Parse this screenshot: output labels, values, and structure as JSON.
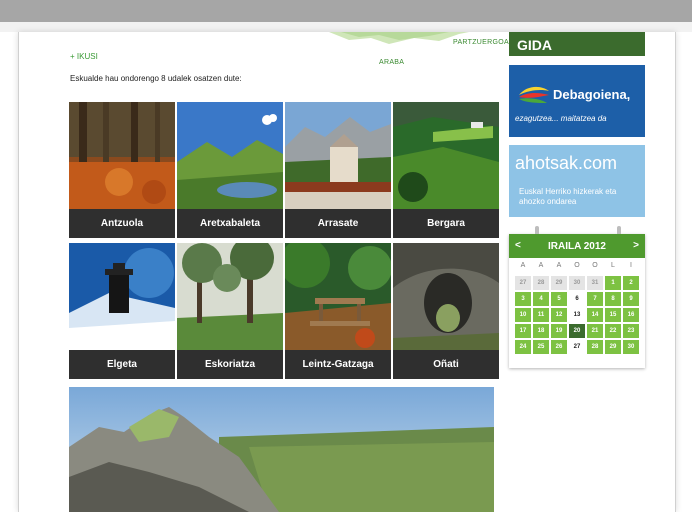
{
  "header": {
    "ikusi_link": "+ IKUSI",
    "intro": "Eskualde hau ondorengo 8 udalek osatzen dute:"
  },
  "map": {
    "label_partzuergoa": "PARTZUERGOA",
    "label_araba": "ARABA"
  },
  "towns": [
    {
      "name": "Antzuola"
    },
    {
      "name": "Aretxabaleta"
    },
    {
      "name": "Arrasate"
    },
    {
      "name": "Bergara"
    },
    {
      "name": "Elgeta"
    },
    {
      "name": "Eskoriatza"
    },
    {
      "name": "Leintz-Gatzaga"
    },
    {
      "name": "Oñati"
    }
  ],
  "sidebar": {
    "gida": "GIDA",
    "debagoiena": {
      "title": "Debagoiena,",
      "tagline": "ezagutzea... maitatzea da"
    },
    "ahotsak": {
      "title": "ahotsak.com",
      "tagline": "Euskal Herriko hizkerak eta ahozko ondarea"
    }
  },
  "calendar": {
    "prev": "<",
    "next": ">",
    "title": "IRAILA 2012",
    "day_headers": [
      "A",
      "A",
      "A",
      "O",
      "O",
      "L",
      "I"
    ],
    "rows": [
      [
        "27",
        "28",
        "29",
        "30",
        "31",
        "1",
        "2"
      ],
      [
        "3",
        "4",
        "5",
        "6",
        "7",
        "8",
        "9"
      ],
      [
        "10",
        "11",
        "12",
        "13",
        "14",
        "15",
        "16"
      ],
      [
        "17",
        "18",
        "19",
        "20",
        "21",
        "22",
        "23"
      ],
      [
        "24",
        "25",
        "26",
        "27",
        "28",
        "29",
        "30"
      ]
    ],
    "colors": {
      "green": "#7dc242",
      "dark": "#3b6b2d",
      "gray": "#e4e4e4",
      "white": "#ffffff"
    }
  }
}
